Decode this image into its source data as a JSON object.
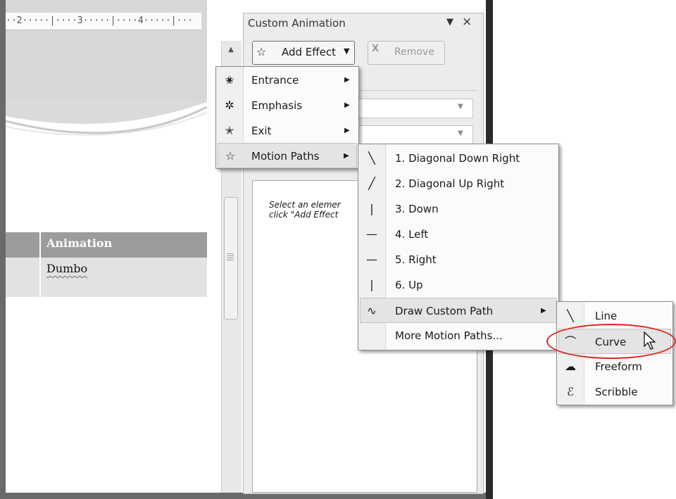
{
  "ruler": {
    "text": "··2·····|····3·····|····4·····|···"
  },
  "slide_table": {
    "header": "Animation",
    "cell": "Dumbo"
  },
  "pane": {
    "title": "Custom Animation",
    "add_effect_label": "Add Effect",
    "remove_label": "Remove",
    "hint_line_1": "Select an elemer",
    "hint_line_2": "click \"Add Effect"
  },
  "effect_menu": {
    "items": [
      {
        "label": "Entrance",
        "icon": "entrance-star-icon",
        "submenu": true
      },
      {
        "label": "Emphasis",
        "icon": "emphasis-star-icon",
        "submenu": true
      },
      {
        "label": "Exit",
        "icon": "exit-star-icon",
        "submenu": true
      },
      {
        "label": "Motion Paths",
        "icon": "motion-path-star-icon",
        "submenu": true,
        "highlighted": true
      }
    ]
  },
  "motion_paths_menu": {
    "items": [
      {
        "label": "1. Diagonal Down Right",
        "icon": "diagonal-down-icon"
      },
      {
        "label": "2. Diagonal Up Right",
        "icon": "diagonal-up-icon"
      },
      {
        "label": "3. Down",
        "icon": "vertical-line-icon"
      },
      {
        "label": "4. Left",
        "icon": "horizontal-line-icon"
      },
      {
        "label": "5. Right",
        "icon": "horizontal-line-icon"
      },
      {
        "label": "6. Up",
        "icon": "vertical-line-icon"
      },
      {
        "label": "Draw Custom Path",
        "icon": "custom-path-icon",
        "submenu": true,
        "highlighted": true
      },
      {
        "label": "More Motion Paths...",
        "icon": ""
      }
    ]
  },
  "custom_path_menu": {
    "items": [
      {
        "label": "Line",
        "icon": "line-icon"
      },
      {
        "label": "Curve",
        "icon": "curve-icon",
        "highlighted": true
      },
      {
        "label": "Freeform",
        "icon": "freeform-icon"
      },
      {
        "label": "Scribble",
        "icon": "scribble-icon"
      }
    ]
  },
  "annotation": {
    "color": "#e0261f"
  }
}
